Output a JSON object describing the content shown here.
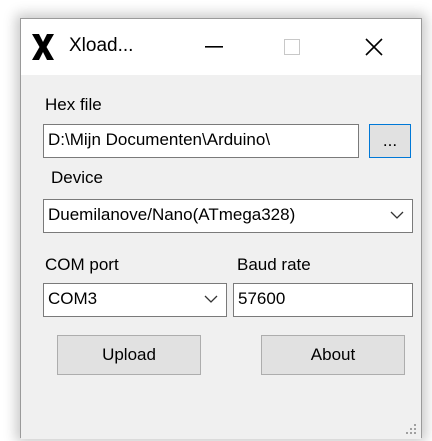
{
  "window": {
    "title": "Xload...",
    "icon": "x-logo-icon",
    "controls": [
      "minimize-icon",
      "maximize-icon",
      "close-icon"
    ]
  },
  "hex_file": {
    "label": "Hex file",
    "value": "D:\\Mijn Documenten\\Arduino\\",
    "browse_label": "..."
  },
  "device": {
    "label": "Device",
    "selected": "Duemilanove/Nano(ATmega328)"
  },
  "com_port": {
    "label": "COM port",
    "selected": "COM3"
  },
  "baud_rate": {
    "label": "Baud rate",
    "value": "57600"
  },
  "buttons": {
    "upload": "Upload",
    "about": "About"
  },
  "colors": {
    "accent": "#0078d7",
    "dialog_bg": "#f0f0f0",
    "button_bg": "#e1e1e1"
  }
}
